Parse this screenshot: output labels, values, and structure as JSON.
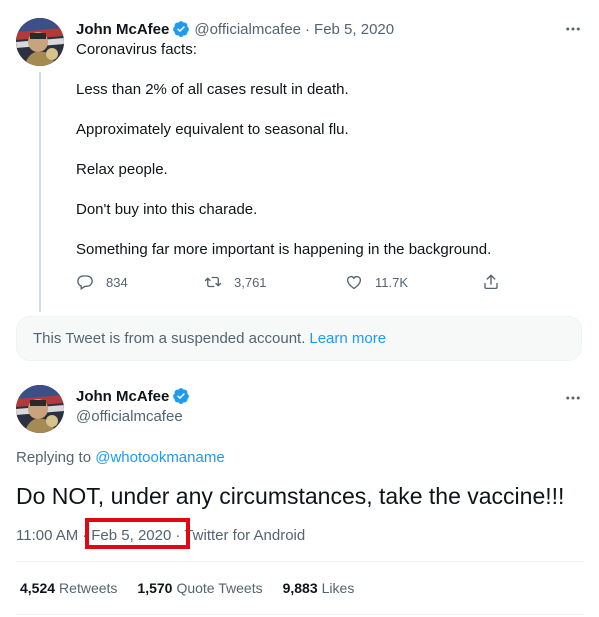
{
  "colors": {
    "accent": "#1d9bf0",
    "muted": "#536471",
    "text": "#0f1419",
    "highlight": "#e30613"
  },
  "tweet1": {
    "author_name": "John McAfee",
    "handle": "@officialmcafee",
    "date": "Feb 5, 2020",
    "lines": [
      "Coronavirus facts:",
      "Less than 2% of all cases result in death.",
      "Approximately equivalent to seasonal flu.",
      "Relax people.",
      "Don't buy into this charade.",
      "Something far more important is happening in the background."
    ],
    "actions": {
      "replies": "834",
      "retweets": "3,761",
      "likes": "11.7K"
    }
  },
  "suspended_notice": {
    "text": "This Tweet is from a suspended account.",
    "link": "Learn more"
  },
  "tweet2": {
    "author_name": "John McAfee",
    "handle": "@officialmcafee",
    "replying_prefix": "Replying to",
    "replying_to": "@whotookmaname",
    "text": "Do NOT, under any circumstances, take the vaccine!!!",
    "time": "11:00 AM",
    "date": "Feb 5, 2020",
    "source": "Twitter for Android",
    "stats": {
      "retweets_count": "4,524",
      "retweets_label": "Retweets",
      "quotes_count": "1,570",
      "quotes_label": "Quote Tweets",
      "likes_count": "9,883",
      "likes_label": "Likes"
    }
  }
}
